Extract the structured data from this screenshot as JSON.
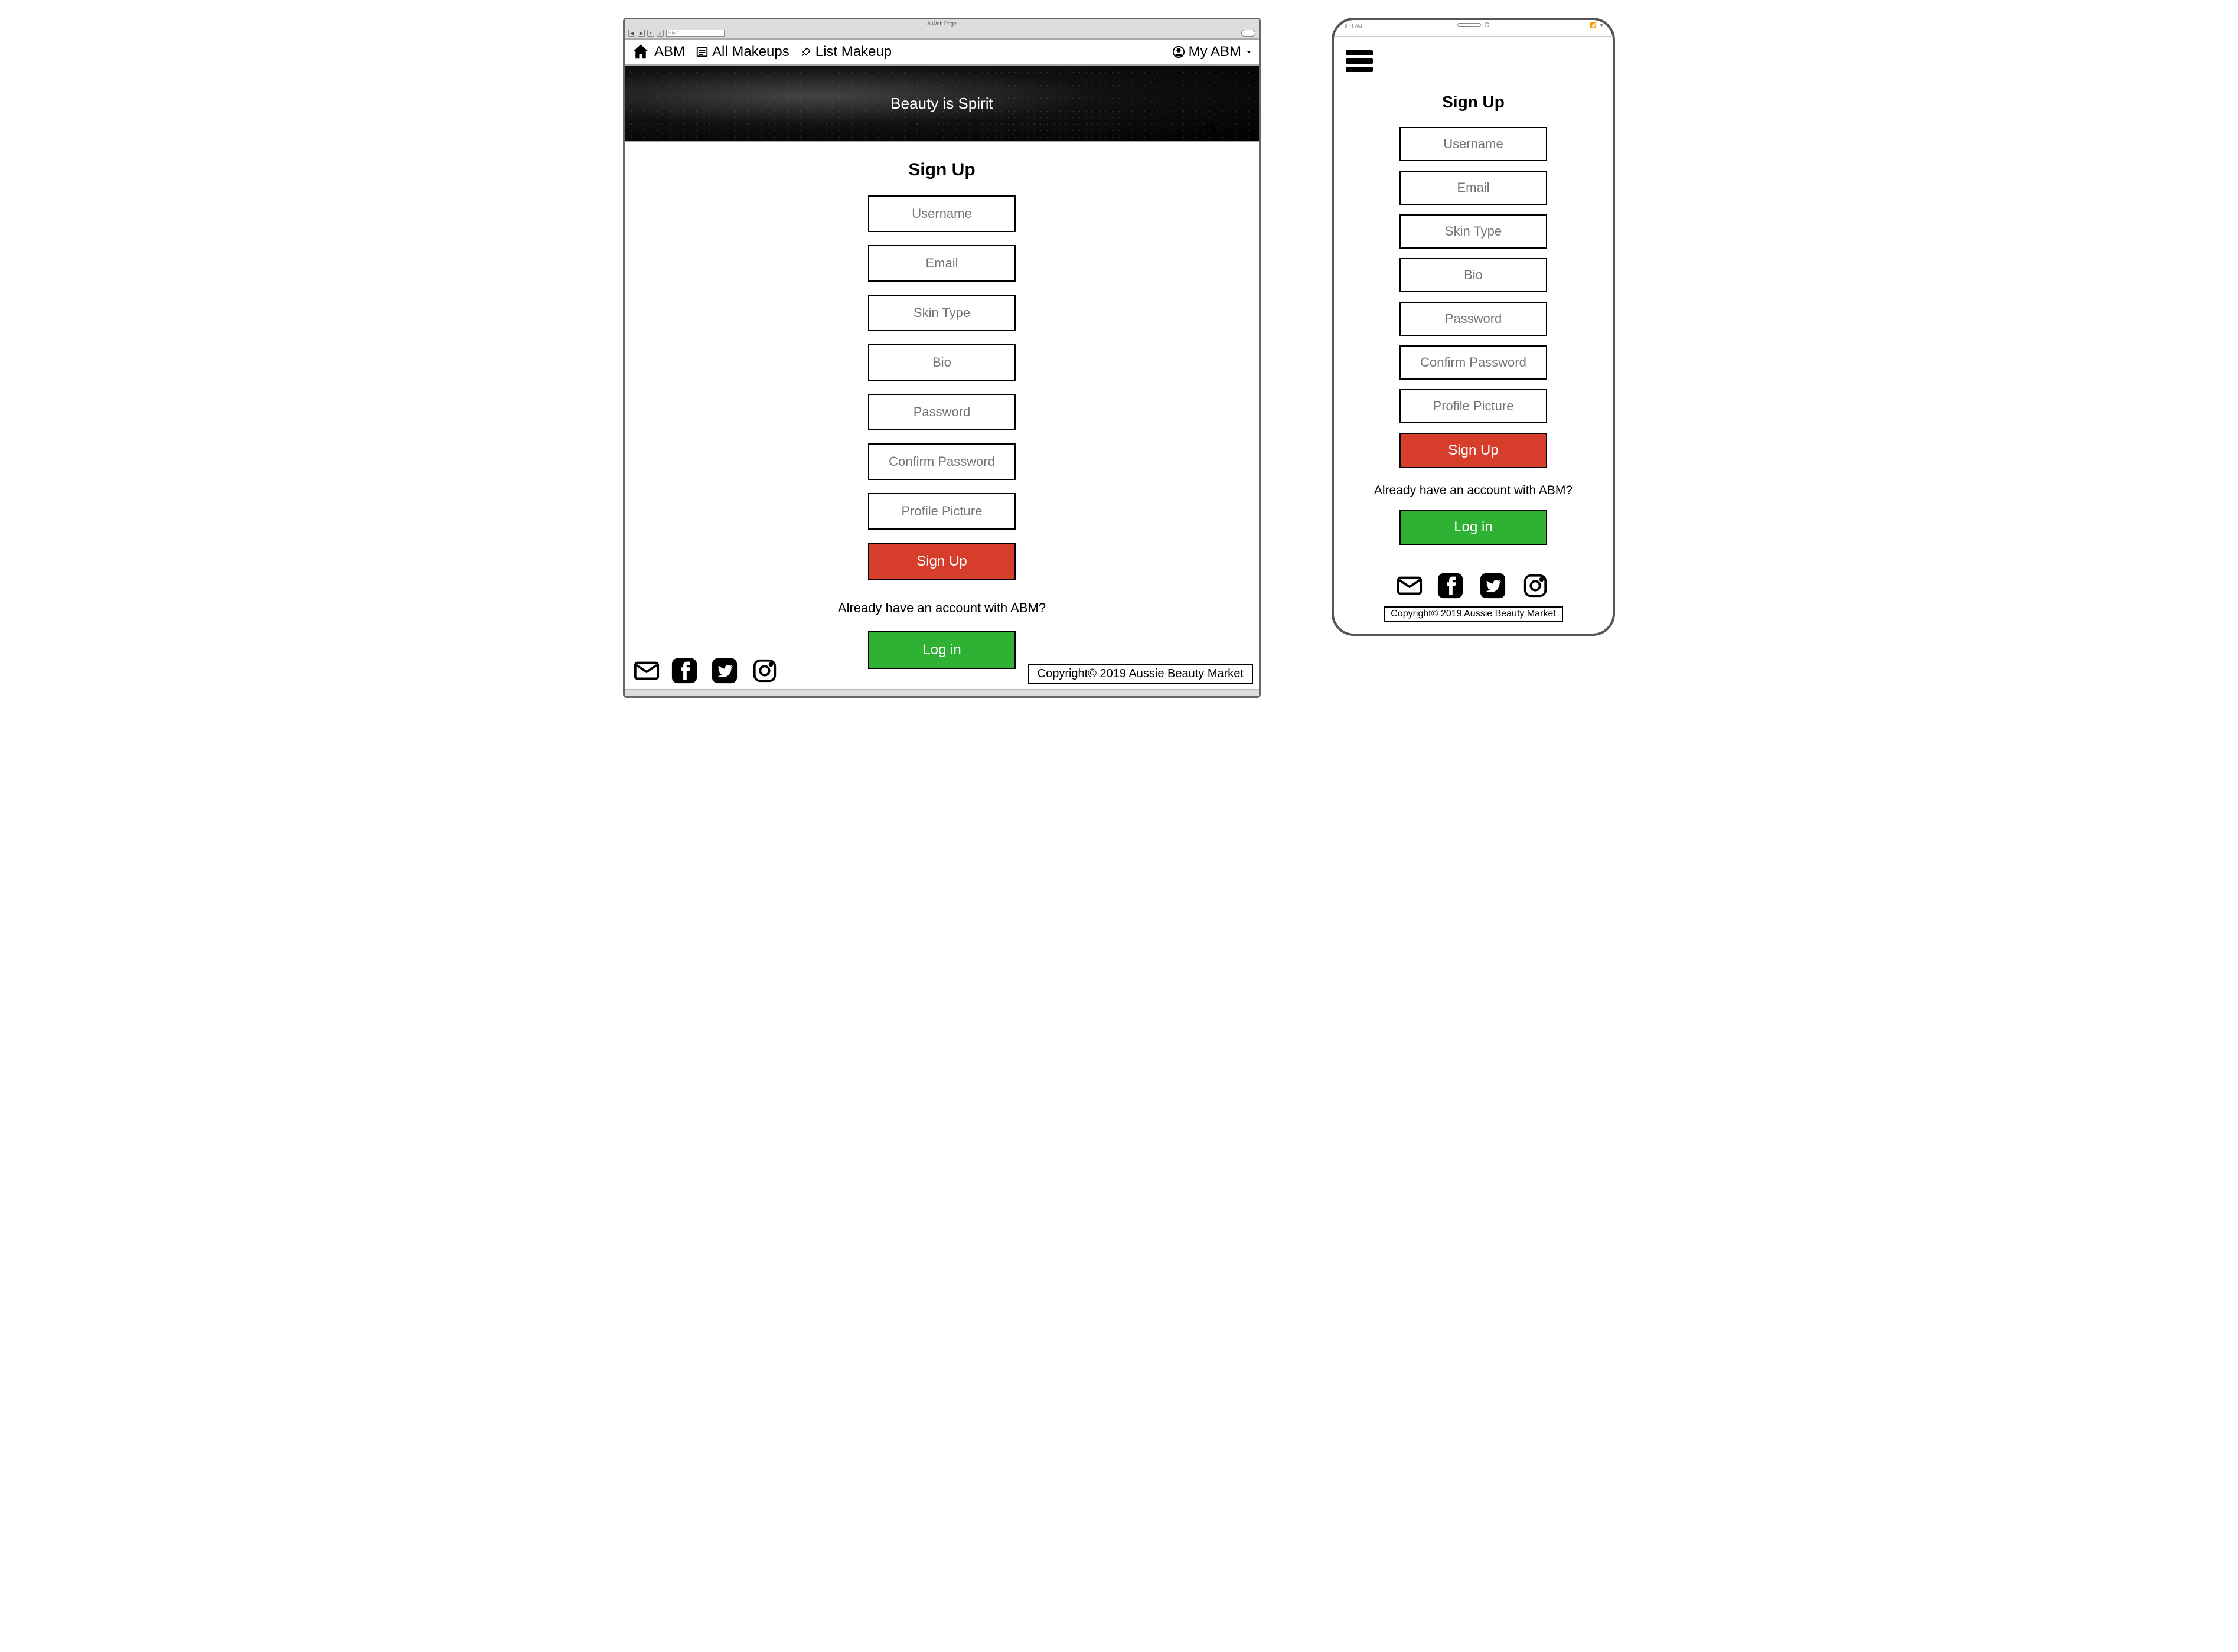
{
  "browser": {
    "title": "A Web Page",
    "address": "http://"
  },
  "nav": {
    "brand": "ABM",
    "all_makeups": "All Makeups",
    "list_makeup": "List Makeup",
    "my_abm": "My ABM"
  },
  "hero": {
    "tagline": "Beauty is Spirit"
  },
  "form": {
    "heading": "Sign Up",
    "fields": {
      "username": "Username",
      "email": "Email",
      "skin_type": "Skin Type",
      "bio": "Bio",
      "password": "Password",
      "confirm_password": "Confirm Password",
      "profile_picture": "Profile Picture"
    },
    "signup_button": "Sign Up",
    "already_text": "Already have an account with ABM?",
    "login_button": "Log in"
  },
  "footer": {
    "copyright": "Copyright© 2019 Aussie Beauty Market"
  },
  "colors": {
    "signup_btn": "#d63d2a",
    "login_btn": "#2fb233"
  }
}
